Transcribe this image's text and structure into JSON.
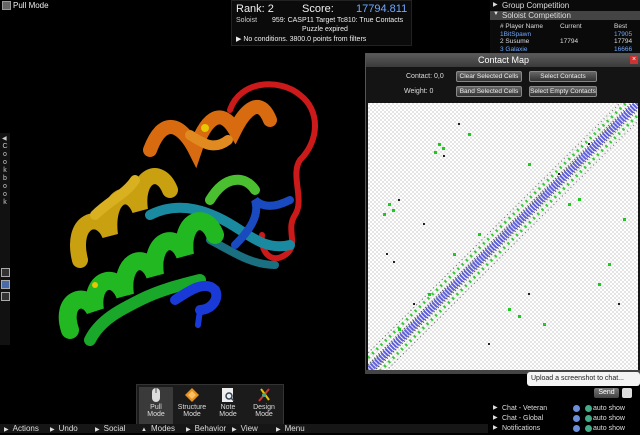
{
  "app": {
    "pull_mode_label": "Pull Mode"
  },
  "score_panel": {
    "rank": "Rank: 2",
    "score_label": "Score:",
    "score_value": "17794.811",
    "soloist": "Soloist",
    "target": "959: CASP11 Target Tc810: True Contacts",
    "expired": "Puzzle expired",
    "conditions": "No conditions. 3800.0 points from filters"
  },
  "cookbook": {
    "label": "Cookbook",
    "letters": [
      "C",
      "o",
      "o",
      "k",
      "b",
      "o",
      "o",
      "k"
    ]
  },
  "competition": {
    "group": "Group Competition",
    "soloist": "Soloist Competition",
    "headers": [
      "# Player Name",
      "Current",
      "Best"
    ],
    "rows": [
      {
        "name": "1BitSpawn",
        "current": "",
        "best": "17905"
      },
      {
        "name": "2 Susume",
        "current": "17794",
        "best": "17794"
      },
      {
        "name": "3 Galaxie",
        "current": "",
        "best": "16666"
      }
    ]
  },
  "contact_map": {
    "title": "Contact Map",
    "contact_label": "Contact: 0,0",
    "weight_label": "Weight: 0",
    "clear_selected": "Clear Selected Cells",
    "select_contacts": "Select Contacts",
    "band_selected": "Band Selected Cells",
    "select_empty": "Select Empty Contacts",
    "close_glyph": "×"
  },
  "modes": [
    {
      "id": "pull",
      "label1": "Pull",
      "label2": "Mode"
    },
    {
      "id": "structure",
      "label1": "Structure",
      "label2": "Mode"
    },
    {
      "id": "note",
      "label1": "Note",
      "label2": "Mode"
    },
    {
      "id": "design",
      "label1": "Design",
      "label2": "Mode"
    }
  ],
  "bottom_bar": {
    "actions": "Actions",
    "undo": "Undo",
    "social": "Social",
    "modes": "Modes",
    "behavior": "Behavior",
    "view": "View",
    "menu": "Menu"
  },
  "chat": {
    "upload_placeholder": "Upload a screenshot to chat...",
    "send": "Send",
    "rows": [
      {
        "name": "Chat - Veteran",
        "auto": "auto show"
      },
      {
        "name": "Chat - Global",
        "auto": "auto show"
      },
      {
        "name": "Notifications",
        "auto": "auto show"
      }
    ]
  },
  "colors": {
    "score_value": "#6fa8ff",
    "player_name_link": "#6fa8ff"
  }
}
